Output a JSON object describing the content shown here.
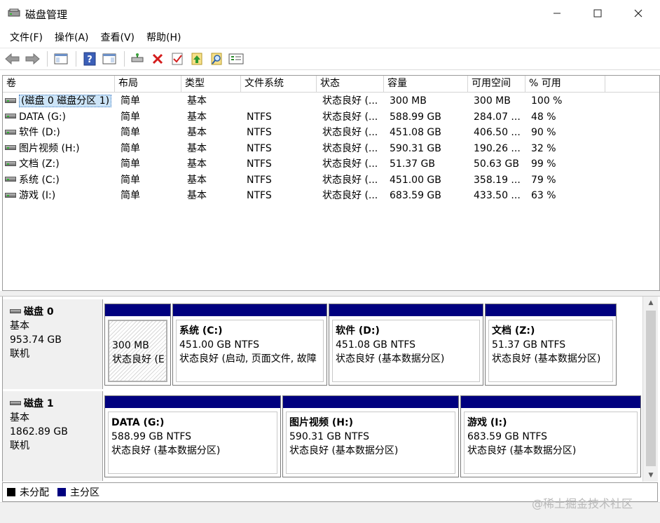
{
  "window": {
    "title": "磁盘管理",
    "minimize_glyph": "—",
    "maximize_glyph": "☐",
    "close_glyph": "✕"
  },
  "menu": [
    "文件(F)",
    "操作(A)",
    "查看(V)",
    "帮助(H)"
  ],
  "toolbar": {
    "buttons": [
      "back-icon",
      "forward-icon",
      "console-tree-icon",
      "help-icon",
      "show-action-pane-icon",
      "connect-icon",
      "delete-icon",
      "properties-icon",
      "refresh-icon",
      "search-icon",
      "export-list-icon"
    ]
  },
  "volume_table": {
    "headers": [
      "卷",
      "布局",
      "类型",
      "文件系统",
      "状态",
      "容量",
      "可用空间",
      "% 可用"
    ],
    "rows": [
      {
        "volume": "(磁盘 0 磁盘分区 1)",
        "layout": "简单",
        "type": "基本",
        "fs": "",
        "status": "状态良好 (...",
        "capacity": "300 MB",
        "free": "300 MB",
        "pct": "100 %"
      },
      {
        "volume": "DATA (G:)",
        "layout": "简单",
        "type": "基本",
        "fs": "NTFS",
        "status": "状态良好 (...",
        "capacity": "588.99 GB",
        "free": "284.07 ...",
        "pct": "48 %"
      },
      {
        "volume": "软件 (D:)",
        "layout": "简单",
        "type": "基本",
        "fs": "NTFS",
        "status": "状态良好 (...",
        "capacity": "451.08 GB",
        "free": "406.50 ...",
        "pct": "90 %"
      },
      {
        "volume": "图片视频 (H:)",
        "layout": "简单",
        "type": "基本",
        "fs": "NTFS",
        "status": "状态良好 (...",
        "capacity": "590.31 GB",
        "free": "190.26 ...",
        "pct": "32 %"
      },
      {
        "volume": "文档 (Z:)",
        "layout": "简单",
        "type": "基本",
        "fs": "NTFS",
        "status": "状态良好 (...",
        "capacity": "51.37 GB",
        "free": "50.63 GB",
        "pct": "99 %"
      },
      {
        "volume": "系统 (C:)",
        "layout": "简单",
        "type": "基本",
        "fs": "NTFS",
        "status": "状态良好 (...",
        "capacity": "451.00 GB",
        "free": "358.19 ...",
        "pct": "79 %"
      },
      {
        "volume": "游戏 (I:)",
        "layout": "简单",
        "type": "基本",
        "fs": "NTFS",
        "status": "状态良好 (...",
        "capacity": "683.59 GB",
        "free": "433.50 ...",
        "pct": "63 %"
      }
    ]
  },
  "disks": [
    {
      "name": "磁盘 0",
      "type": "基本",
      "size": "953.74 GB",
      "state": "联机",
      "partitions": [
        {
          "title": "",
          "size": "300 MB",
          "status": "状态良好 (E"
        },
        {
          "title": "系统 (C:)",
          "size": "451.00 GB NTFS",
          "status": "状态良好 (启动, 页面文件, 故障"
        },
        {
          "title": "软件 (D:)",
          "size": "451.08 GB NTFS",
          "status": "状态良好 (基本数据分区)"
        },
        {
          "title": "文档 (Z:)",
          "size": "51.37 GB NTFS",
          "status": "状态良好 (基本数据分区)"
        }
      ]
    },
    {
      "name": "磁盘 1",
      "type": "基本",
      "size": "1862.89 GB",
      "state": "联机",
      "partitions": [
        {
          "title": "DATA (G:)",
          "size": "588.99 GB NTFS",
          "status": "状态良好 (基本数据分区)"
        },
        {
          "title": "图片视频 (H:)",
          "size": "590.31 GB NTFS",
          "status": "状态良好 (基本数据分区)"
        },
        {
          "title": "游戏 (I:)",
          "size": "683.59 GB NTFS",
          "status": "状态良好 (基本数据分区)"
        }
      ]
    }
  ],
  "legend": [
    {
      "label": "未分配",
      "color": "#000000"
    },
    {
      "label": "主分区",
      "color": "#00007f"
    }
  ],
  "watermark": "@稀土掘金技术社区"
}
